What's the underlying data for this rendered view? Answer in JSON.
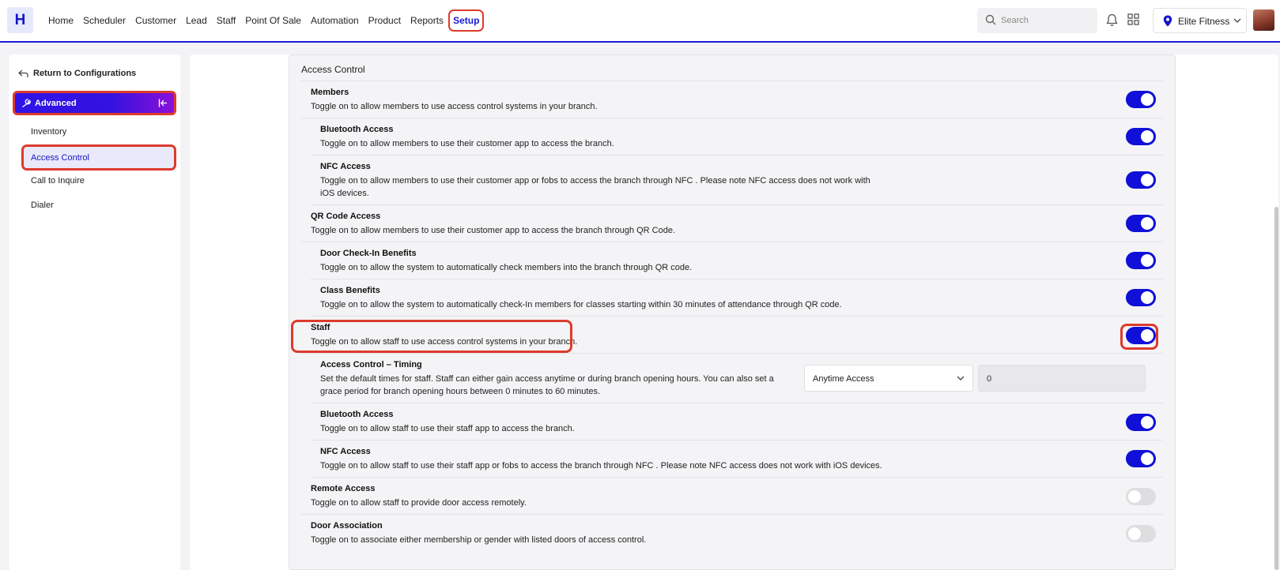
{
  "app": {
    "logo_letter": "H"
  },
  "nav": {
    "items": [
      "Home",
      "Scheduler",
      "Customer",
      "Lead",
      "Staff",
      "Point Of Sale",
      "Automation",
      "Product",
      "Reports"
    ],
    "active": "Setup"
  },
  "header": {
    "search_placeholder": "Search",
    "branch_name": "Elite Fitness"
  },
  "sidebar": {
    "return_label": "Return to Configurations",
    "section_label": "Advanced",
    "items": [
      "Inventory",
      "Access Control",
      "Call to Inquire",
      "Dialer"
    ],
    "active_item": "Access Control"
  },
  "section": {
    "title": "Access Control"
  },
  "settings": [
    {
      "title": "Members",
      "description": "Toggle on to allow members to use access control systems in your branch.",
      "enabled": true
    },
    {
      "title": "Bluetooth Access",
      "description": "Toggle on to allow members to use their customer app to access the branch.",
      "enabled": true
    },
    {
      "title": "NFC Access",
      "description": "Toggle on to allow members to use their customer app or fobs to access the branch through NFC . Please note NFC access does not work with iOS devices.",
      "enabled": true
    },
    {
      "title": "QR Code Access",
      "description": "Toggle on to allow members to use their customer app to access the branch through QR Code.",
      "enabled": true
    },
    {
      "title": "Door Check-In Benefits",
      "description": "Toggle on to allow the system to automatically check members into the branch through QR code.",
      "enabled": true
    },
    {
      "title": "Class Benefits",
      "description": "Toggle on to allow the system to automatically check-In members for classes starting within 30 minutes of attendance through QR code.",
      "enabled": true
    },
    {
      "title": "Staff",
      "description": "Toggle on to allow staff to use access control systems in your branch.",
      "enabled": true
    },
    {
      "title": "Access Control – Timing",
      "description": "Set the default times for staff. Staff can either gain access anytime or during branch opening hours. You can also set a grace period for branch opening hours between 0 minutes to 60 minutes."
    },
    {
      "title": "Bluetooth Access",
      "description": "Toggle on to allow staff to use their staff app to access the branch.",
      "enabled": true
    },
    {
      "title": "NFC Access",
      "description": "Toggle on to allow staff to use their staff app or fobs to access the branch through NFC . Please note NFC access does not work with iOS devices.",
      "enabled": true
    },
    {
      "title": "Remote Access",
      "description": "Toggle on to allow staff to provide door access remotely.",
      "enabled": false
    },
    {
      "title": "Door Association",
      "description": "Toggle on to associate either membership or gender with listed doors of access control.",
      "enabled": false
    }
  ],
  "timing": {
    "access_option": "Anytime Access",
    "grace_minutes": "0"
  },
  "colors": {
    "brand": "#1616c8",
    "toggle_on": "#1010d8",
    "highlight": "#dc3b2c"
  }
}
